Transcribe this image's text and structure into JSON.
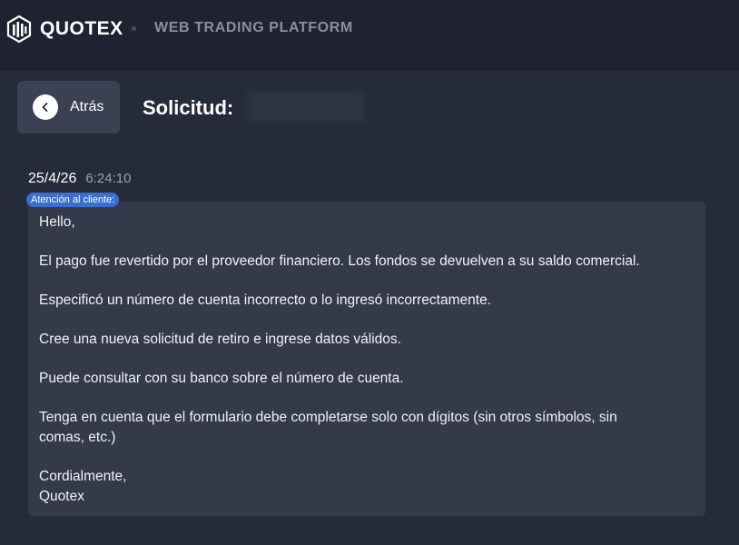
{
  "header": {
    "brand": "QUOTEX",
    "platform": "WEB TRADING PLATFORM"
  },
  "toolbar": {
    "back_label": "Atrás",
    "title": "Solicitud:"
  },
  "ticket": {
    "date": "25/4/26",
    "time": "6:24:10",
    "sender_badge": "Atención al cliente:",
    "message": {
      "greeting": "Hello,",
      "p1": "El pago fue revertido por el proveedor financiero. Los fondos se devuelven a su saldo comercial.",
      "p2": "Especificó un número de cuenta incorrecto o lo ingresó incorrectamente.",
      "p3": "Cree una nueva solicitud de retiro e ingrese datos válidos.",
      "p4": "Puede consultar con su banco sobre el número de cuenta.",
      "p5_line1": "Tenga en cuenta que el formulario debe completarse solo con dígitos (sin otros símbolos, sin",
      "p5_line2": "comas, etc.)",
      "closing": "Cordialmente,",
      "signature": "Quotex"
    }
  },
  "icons": {
    "logo": "quotex-logo-icon",
    "back": "chevron-left-icon"
  }
}
